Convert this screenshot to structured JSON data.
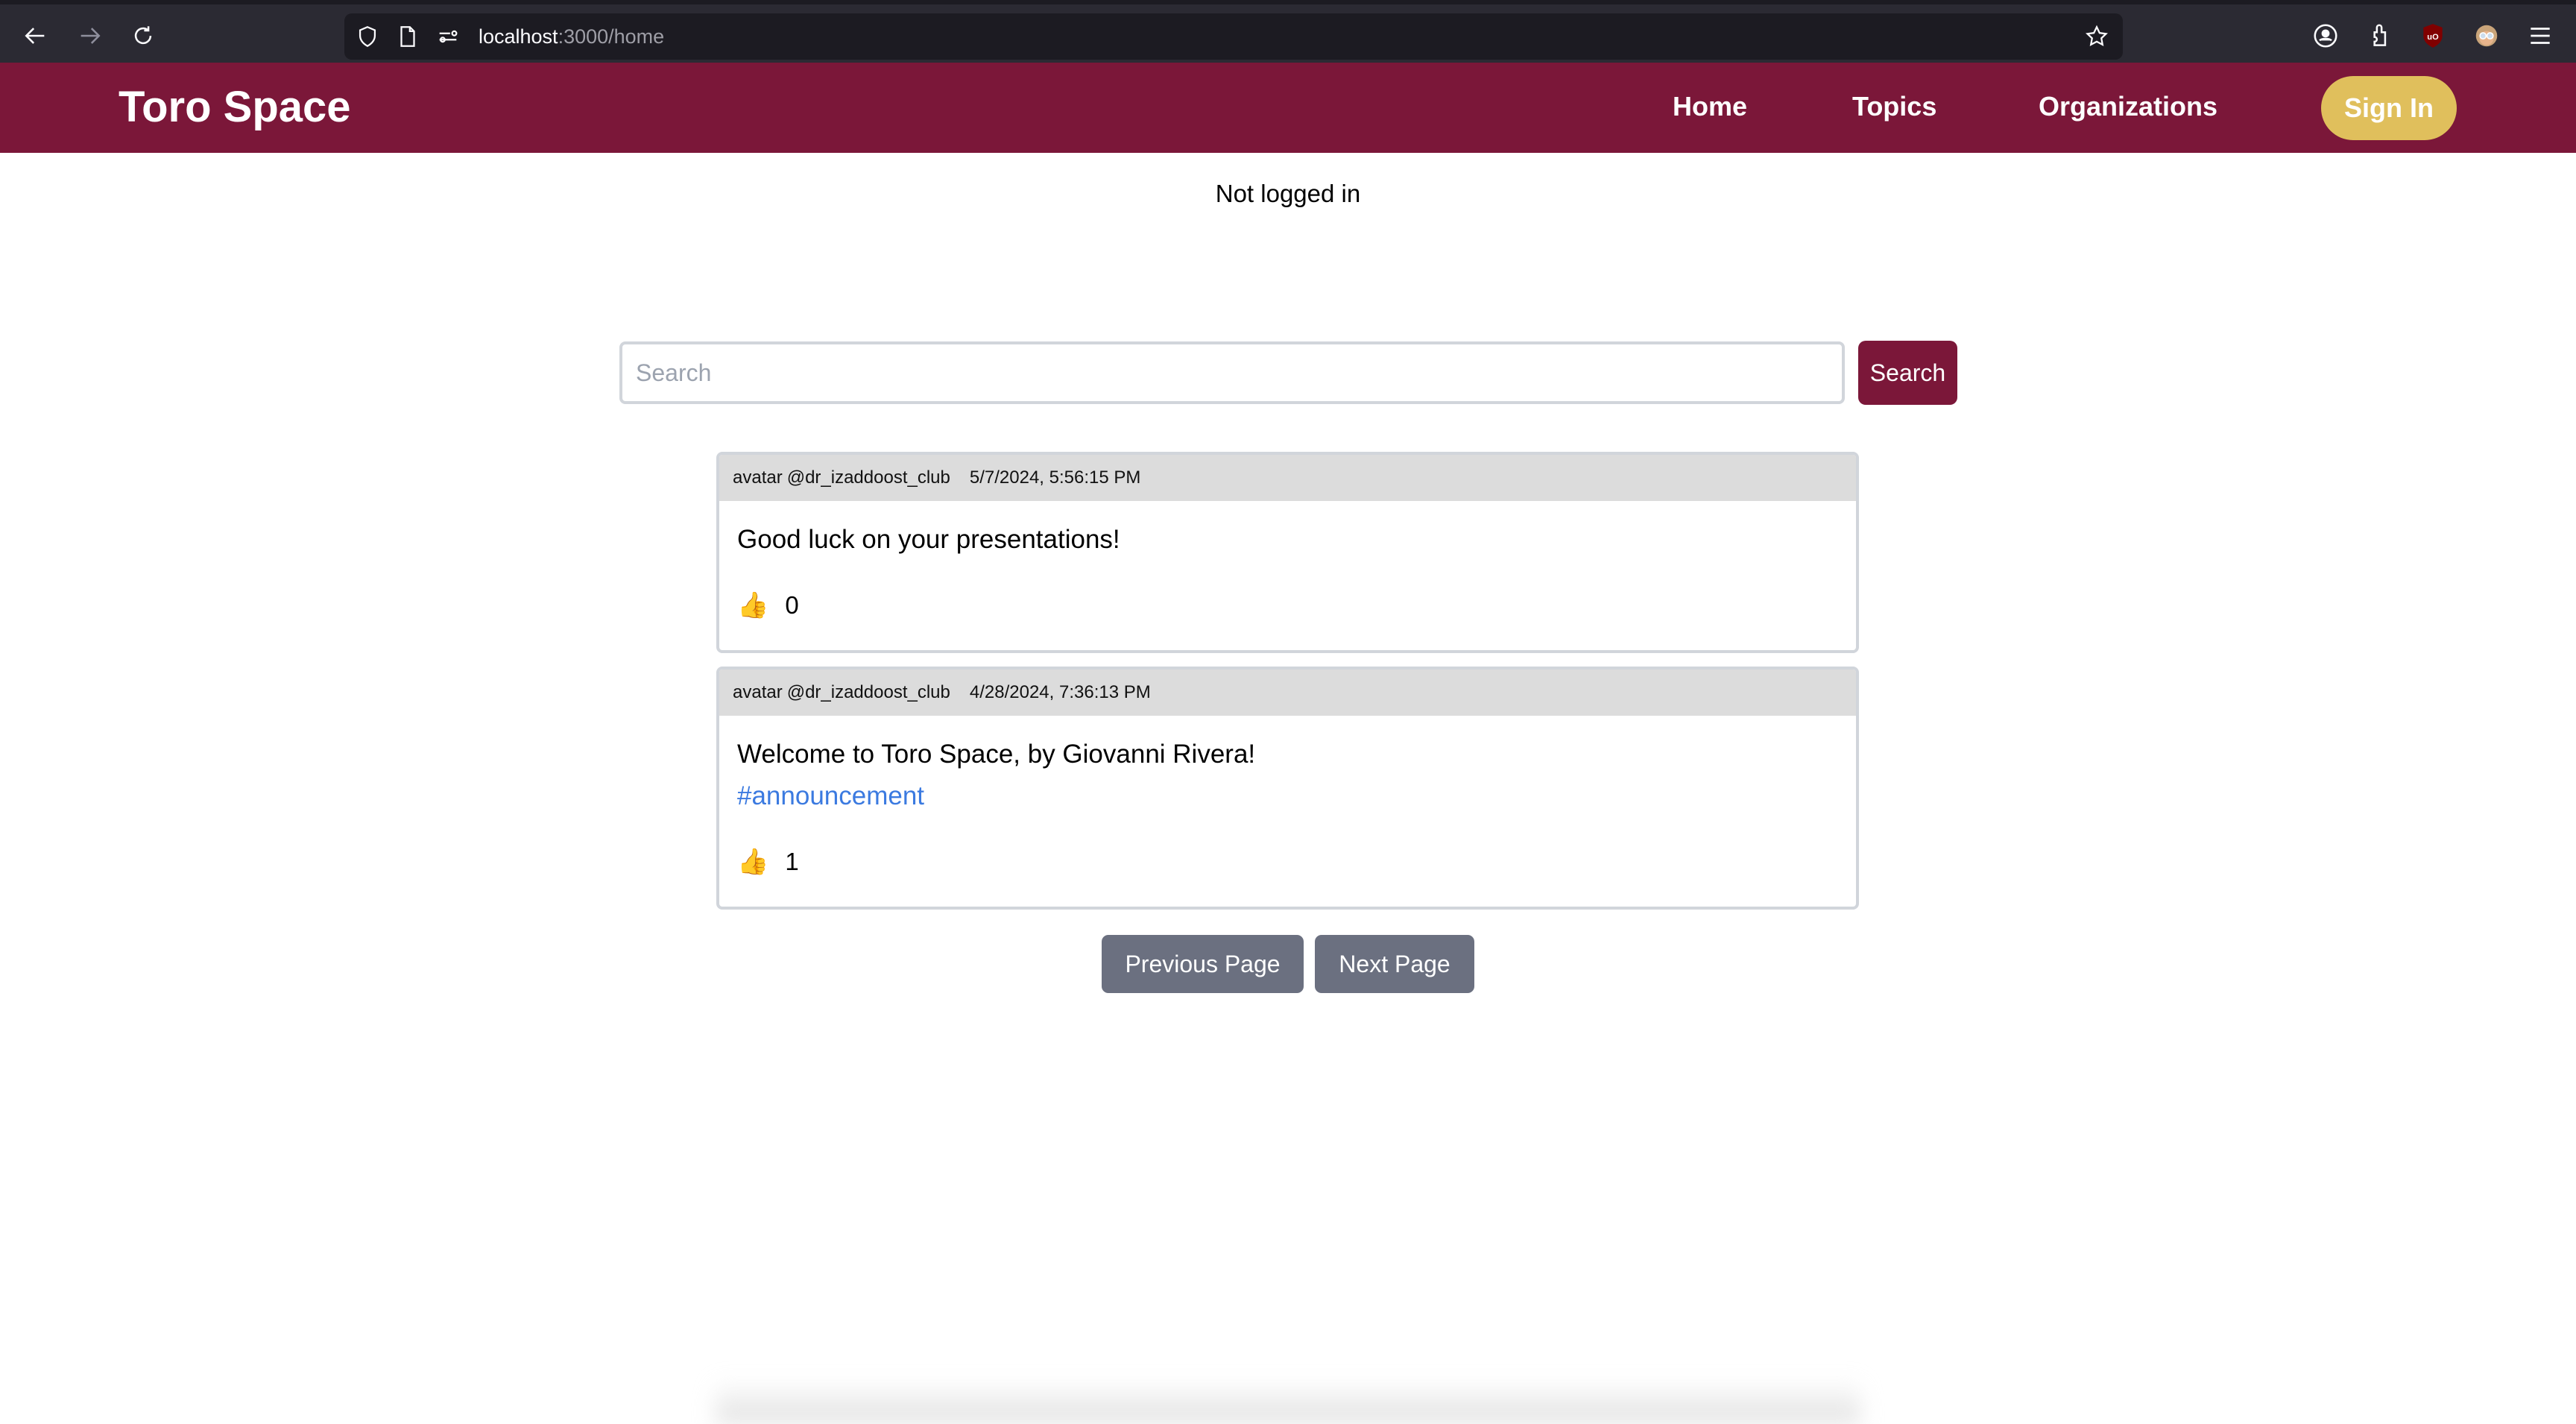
{
  "browser": {
    "url_host": "localhost",
    "url_rest": ":3000/home",
    "icons": {
      "back": "arrow-left-icon",
      "forward": "arrow-right-icon",
      "reload": "reload-icon",
      "shield": "tracking-protection-shield-icon",
      "page": "page-icon",
      "permissions": "permissions-sliders-icon",
      "bookmark": "star-icon",
      "account": "account-icon",
      "extensions": "puzzle-extensions-icon",
      "ublock": "ublock-origin-icon",
      "profile": "profile-avatar-icon",
      "menu": "hamburger-menu-icon"
    }
  },
  "header": {
    "brand": "Toro Space",
    "nav": [
      {
        "label": "Home"
      },
      {
        "label": "Topics"
      },
      {
        "label": "Organizations"
      }
    ],
    "sign_in_label": "Sign In",
    "colors": {
      "primary": "#7b1739",
      "accent": "#e0bf5c"
    }
  },
  "status": {
    "login_text": "Not logged in"
  },
  "search": {
    "placeholder": "Search",
    "value": "",
    "button_label": "Search"
  },
  "posts": [
    {
      "avatar_alt": "avatar",
      "author": "@dr_izaddoost_club",
      "timestamp": "5/7/2024, 5:56:15 PM",
      "content": "Good luck on your presentations!",
      "hashtag": "",
      "likes": "0"
    },
    {
      "avatar_alt": "avatar",
      "author": "@dr_izaddoost_club",
      "timestamp": "4/28/2024, 7:36:13 PM",
      "content": "Welcome to Toro Space, by Giovanni Rivera!",
      "hashtag": "#announcement",
      "likes": "1"
    }
  ],
  "pagination": {
    "previous_label": "Previous Page",
    "next_label": "Next Page"
  },
  "like_icon": "👍"
}
